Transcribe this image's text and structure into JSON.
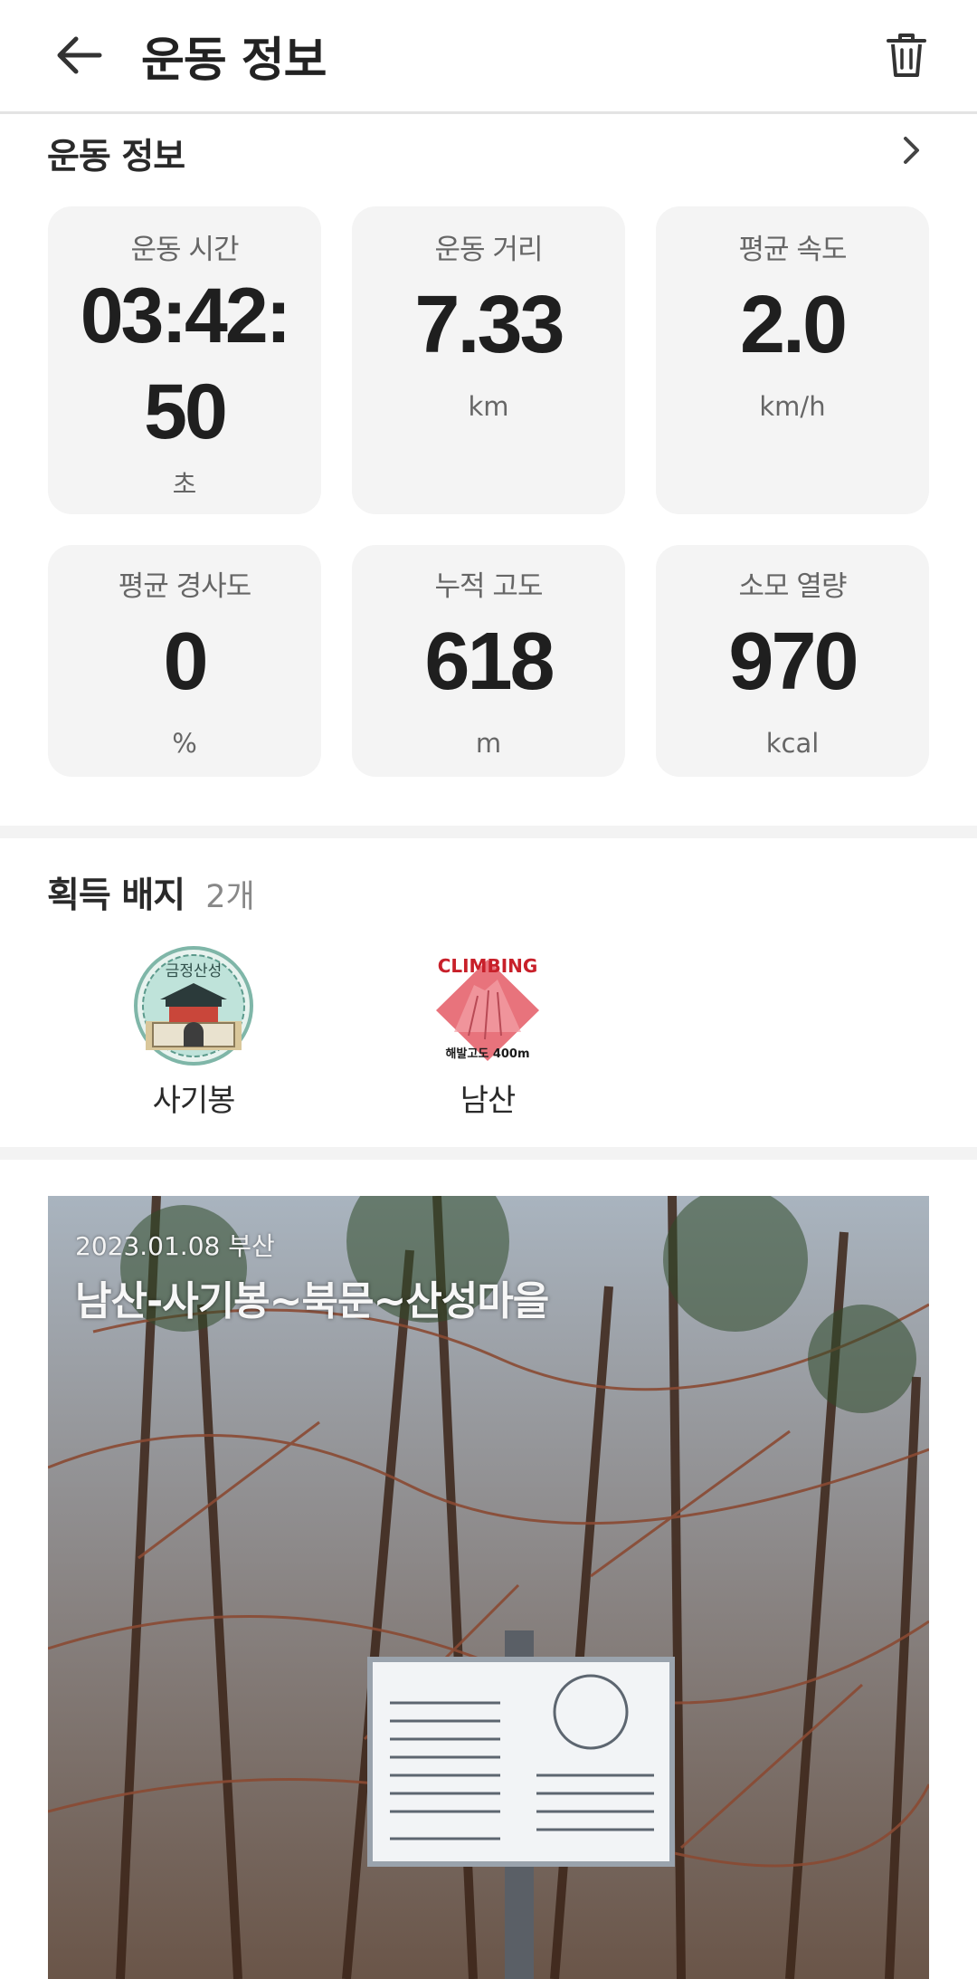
{
  "appbar": {
    "title": "운동 정보",
    "back_icon": "arrow-left-icon",
    "delete_icon": "trash-icon"
  },
  "workout_section": {
    "title": "운동 정보",
    "chevron_icon": "chevron-right-icon"
  },
  "stats": [
    {
      "label": "운동 시간",
      "value": "03:42:50",
      "unit": "초"
    },
    {
      "label": "운동 거리",
      "value": "7.33",
      "unit": "km"
    },
    {
      "label": "평균 속도",
      "value": "2.0",
      "unit": "km/h"
    },
    {
      "label": "평균 경사도",
      "value": "0",
      "unit": "%"
    },
    {
      "label": "누적 고도",
      "value": "618",
      "unit": "m"
    },
    {
      "label": "소모 열량",
      "value": "970",
      "unit": "kcal"
    }
  ],
  "badges": {
    "title": "획득 배지",
    "count": "2개",
    "items": [
      {
        "name": "사기봉",
        "emblem_text": "금정산성"
      },
      {
        "name": "남산",
        "emblem_text": "CLIMBING",
        "emblem_subtext": "해발고도 400m"
      }
    ]
  },
  "photo": {
    "date": "2023.01.08 부산",
    "caption": "남산-사기봉~북문~산성마을"
  },
  "colors": {
    "card_bg": "#f4f4f4",
    "divider": "#f3f3f3",
    "badge_pink": "#e8737c",
    "badge_red": "#c8202a"
  }
}
